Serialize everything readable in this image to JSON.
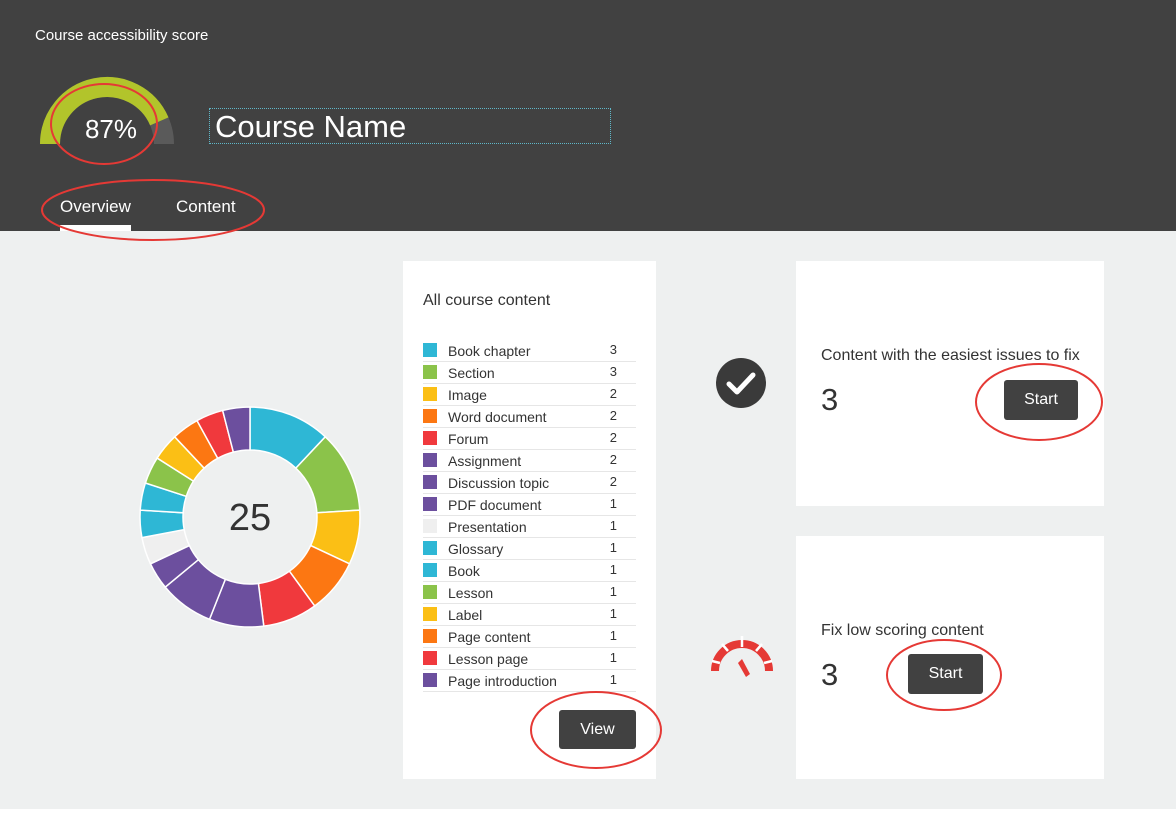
{
  "header": {
    "score_label": "Course accessibility score",
    "score_percent": "87%",
    "score_value": 0.87,
    "course_name": "Course Name",
    "tabs": [
      {
        "label": "Overview",
        "active": true
      },
      {
        "label": "Content",
        "active": false
      }
    ],
    "colors": {
      "background": "#414141",
      "gauge_fill": "#b2c42b"
    }
  },
  "overview": {
    "total": "25",
    "list_title": "All course content",
    "view_label": "View",
    "items": [
      {
        "name": "Book chapter",
        "count": "3",
        "color": "#2eb7d5"
      },
      {
        "name": "Section",
        "count": "3",
        "color": "#8bc34a"
      },
      {
        "name": "Image",
        "count": "2",
        "color": "#fbbf15"
      },
      {
        "name": "Word document",
        "count": "2",
        "color": "#fc7712"
      },
      {
        "name": "Forum",
        "count": "2",
        "color": "#f0393d"
      },
      {
        "name": "Assignment",
        "count": "2",
        "color": "#6c4f9e"
      },
      {
        "name": "Discussion topic",
        "count": "2",
        "color": "#6c4f9e"
      },
      {
        "name": "PDF document",
        "count": "1",
        "color": "#6c4f9e"
      },
      {
        "name": "Presentation",
        "count": "1",
        "color": "#efefef"
      },
      {
        "name": "Glossary",
        "count": "1",
        "color": "#2eb7d5"
      },
      {
        "name": "Book",
        "count": "1",
        "color": "#2eb7d5"
      },
      {
        "name": "Lesson",
        "count": "1",
        "color": "#8bc34a"
      },
      {
        "name": "Label",
        "count": "1",
        "color": "#fbbf15"
      },
      {
        "name": "Page content",
        "count": "1",
        "color": "#fc7712"
      },
      {
        "name": "Lesson page",
        "count": "1",
        "color": "#f0393d"
      },
      {
        "name": "Page introduction",
        "count": "1",
        "color": "#6c4f9e"
      }
    ]
  },
  "easy_fix": {
    "heading": "Content with the easiest issues to fix",
    "count": "3",
    "start_label": "Start",
    "icon": "check-circle-icon"
  },
  "low_score": {
    "heading": "Fix low scoring content",
    "count": "3",
    "start_label": "Start",
    "icon": "speedometer-icon",
    "icon_color": "#e53935"
  },
  "colors": {
    "page_bg": "#eef0f0",
    "card_bg": "#ffffff",
    "button_bg": "#414141",
    "annotation": "#e53935"
  }
}
